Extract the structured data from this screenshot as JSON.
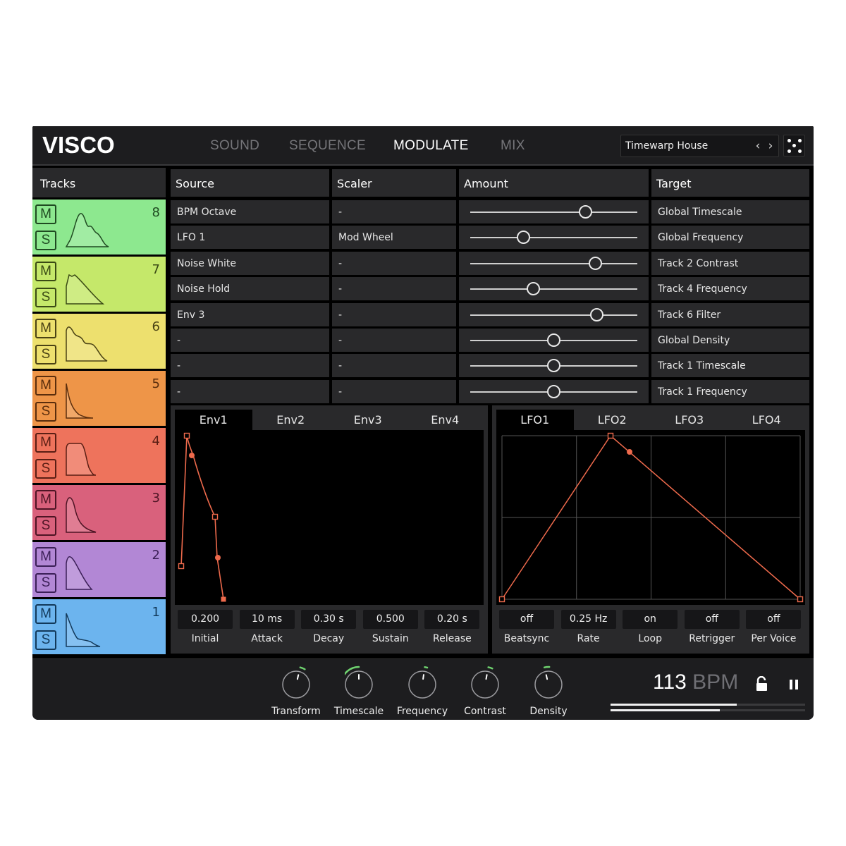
{
  "header": {
    "logo": "VISCO",
    "nav_tabs": [
      {
        "label": "SOUND",
        "active": false
      },
      {
        "label": "SEQUENCE",
        "active": false
      },
      {
        "label": "MODULATE",
        "active": true
      },
      {
        "label": "MIX",
        "active": false
      }
    ],
    "preset": {
      "name": "Timewarp House",
      "prev_icon": "chevron-left-icon",
      "next_icon": "chevron-right-icon"
    },
    "randomize_icon": "dice-icon"
  },
  "tracks": {
    "title": "Tracks",
    "mute_label": "M",
    "solo_label": "S",
    "items": [
      {
        "number": "8",
        "color": "#8de88f",
        "ink": "#1f4a21"
      },
      {
        "number": "7",
        "color": "#c5e86a",
        "ink": "#3a4a14"
      },
      {
        "number": "6",
        "color": "#ede06e",
        "ink": "#4a4214"
      },
      {
        "number": "5",
        "color": "#ee9548",
        "ink": "#5a2d0c"
      },
      {
        "number": "4",
        "color": "#ee735c",
        "ink": "#5a1e14"
      },
      {
        "number": "3",
        "color": "#d9617c",
        "ink": "#4d1424"
      },
      {
        "number": "2",
        "color": "#b287d5",
        "ink": "#3b1f57"
      },
      {
        "number": "1",
        "color": "#6cb4ee",
        "ink": "#12395a"
      }
    ]
  },
  "matrix": {
    "headers": {
      "source": "Source",
      "scaler": "Scaler",
      "amount": "Amount",
      "target": "Target"
    },
    "rows": [
      {
        "source": "BPM Octave",
        "scaler": "-",
        "amount": 0.69,
        "target": "Global Timescale"
      },
      {
        "source": "LFO 1",
        "scaler": "Mod Wheel",
        "amount": 0.32,
        "target": "Global Frequency"
      },
      {
        "source": "Noise White",
        "scaler": "-",
        "amount": 0.75,
        "target": "Track 2 Contrast"
      },
      {
        "source": "Noise Hold",
        "scaler": "-",
        "amount": 0.38,
        "target": "Track 4 Frequency"
      },
      {
        "source": "Env 3",
        "scaler": "-",
        "amount": 0.76,
        "target": "Track 6 Filter"
      },
      {
        "source": "-",
        "scaler": "-",
        "amount": 0.5,
        "target": "Global Density"
      },
      {
        "source": "-",
        "scaler": "-",
        "amount": 0.5,
        "target": "Track 1 Timescale"
      },
      {
        "source": "-",
        "scaler": "-",
        "amount": 0.5,
        "target": "Track 1 Frequency"
      }
    ]
  },
  "envelope": {
    "tabs": [
      "Env1",
      "Env2",
      "Env3",
      "Env4"
    ],
    "active_tab": 0,
    "color": "#ee6a4c",
    "params": [
      {
        "value": "0.200",
        "label": "Initial"
      },
      {
        "value": "10 ms",
        "label": "Attack"
      },
      {
        "value": "0.30 s",
        "label": "Decay"
      },
      {
        "value": "0.500",
        "label": "Sustain"
      },
      {
        "value": "0.20 s",
        "label": "Release"
      }
    ]
  },
  "lfo": {
    "tabs": [
      "LFO1",
      "LFO2",
      "LFO3",
      "LFO4"
    ],
    "active_tab": 0,
    "color": "#ee6a4c",
    "params": [
      {
        "value": "off",
        "label": "Beatsync"
      },
      {
        "value": "0.25 Hz",
        "label": "Rate"
      },
      {
        "value": "on",
        "label": "Loop"
      },
      {
        "value": "off",
        "label": "Retrigger"
      },
      {
        "value": "off",
        "label": "Per Voice"
      }
    ]
  },
  "footer": {
    "knobs": [
      {
        "label": "Transform",
        "value": 0.55,
        "mod": 0.06
      },
      {
        "label": "Timescale",
        "value": 0.5,
        "mod": -0.3
      },
      {
        "label": "Frequency",
        "value": 0.53,
        "mod": 0.03
      },
      {
        "label": "Contrast",
        "value": 0.54,
        "mod": 0.05
      },
      {
        "label": "Density",
        "value": 0.45,
        "mod": 0.06
      }
    ],
    "bpm_value": "113",
    "bpm_unit": "BPM",
    "lock_icon": "unlock-icon",
    "transport_icon": "pause-icon",
    "meters": [
      0.65,
      0.56
    ],
    "accent": "#6fd36f"
  }
}
